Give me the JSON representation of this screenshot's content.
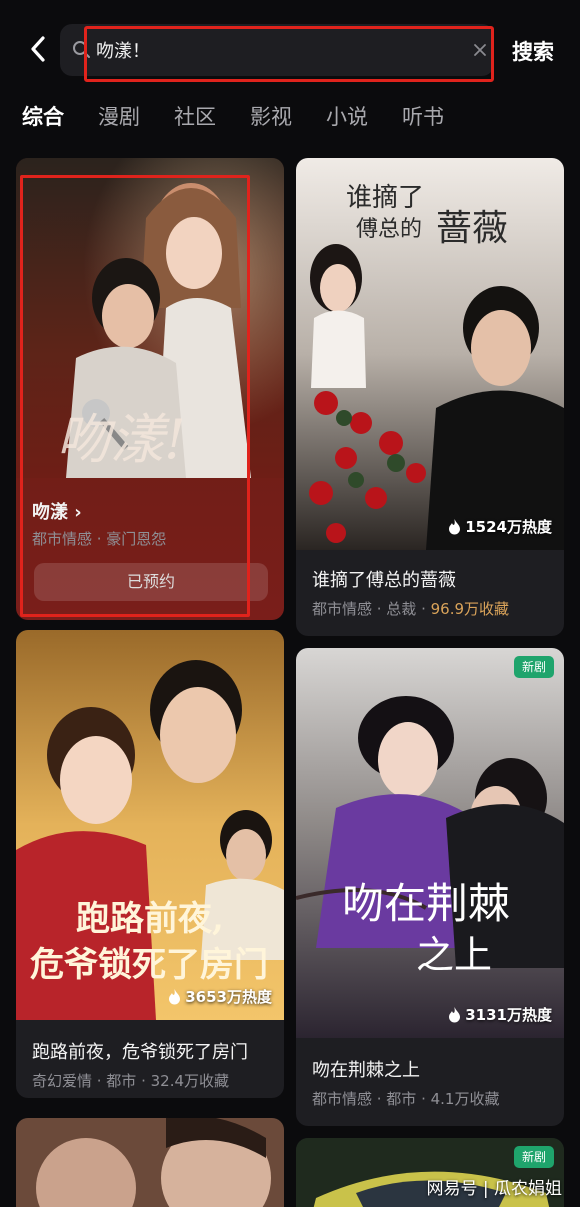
{
  "search": {
    "query": "吻漾！",
    "button_label": "搜索"
  },
  "tabs": [
    {
      "label": "综合",
      "active": true
    },
    {
      "label": "漫剧"
    },
    {
      "label": "社区"
    },
    {
      "label": "影视"
    },
    {
      "label": "小说"
    },
    {
      "label": "听书"
    }
  ],
  "cards": [
    {
      "title": "吻漾 ›",
      "meta": "都市情感 · 豪门恩怨",
      "button": "已预约"
    },
    {
      "title": "谁摘了傅总的蔷薇",
      "meta_prefix": "都市情感 · 总裁 · ",
      "meta_highlight": "96.9万收藏",
      "heat": "1524万热度"
    },
    {
      "title": "跑路前夜，危爷锁死了房门",
      "meta": "奇幻爱情 · 都市 · 32.4万收藏",
      "heat": "3653万热度"
    },
    {
      "title": "吻在荆棘之上",
      "meta": "都市情感 · 都市 · 4.1万收藏",
      "heat": "3131万热度",
      "badge": "新剧"
    },
    {
      "title": ""
    },
    {
      "badge": "新剧"
    }
  ],
  "watermark": "网易号 | 瓜农娟姐",
  "colors": {
    "highlight_box": "#e0231c",
    "new_badge": "#1fa46c",
    "collect_highlight": "#d9a35a"
  }
}
